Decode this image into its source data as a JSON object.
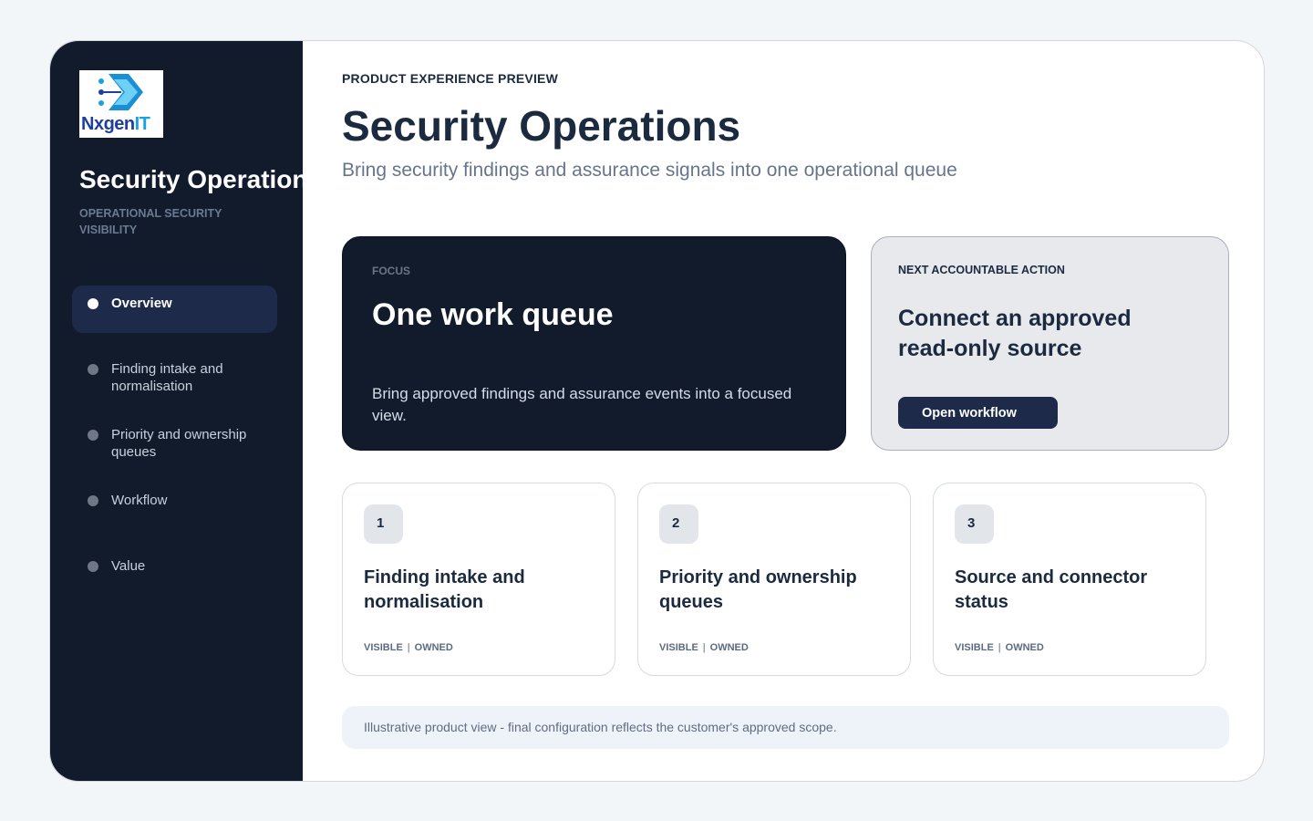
{
  "sidebar": {
    "logo_text_a": "Nxgen",
    "logo_text_b": "IT",
    "brand_title": "Security Operations",
    "brand_subtitle": "OPERATIONAL SECURITY VISIBILITY",
    "items": [
      {
        "label": "Overview",
        "active": true
      },
      {
        "label": "Finding intake and normalisation"
      },
      {
        "label": "Priority and ownership queues"
      },
      {
        "label": "Workflow"
      },
      {
        "label": "Value"
      }
    ]
  },
  "header": {
    "eyebrow": "PRODUCT EXPERIENCE PREVIEW",
    "title": "Security Operations",
    "subtitle": "Bring security findings and assurance signals into one operational queue"
  },
  "focus": {
    "eyebrow": "FOCUS",
    "title": "One work queue",
    "text": "Bring approved findings and assurance events into a focused view."
  },
  "next_action": {
    "eyebrow": "NEXT ACCOUNTABLE ACTION",
    "title": "Connect an approved read-only source",
    "button_label": "Open workflow"
  },
  "steps": [
    {
      "number": "1",
      "title": "Finding intake and normalisation",
      "tag_a": "VISIBLE",
      "sep": "|",
      "tag_b": "OWNED"
    },
    {
      "number": "2",
      "title": "Priority and ownership queues",
      "tag_a": "VISIBLE",
      "sep": "|",
      "tag_b": "OWNED"
    },
    {
      "number": "3",
      "title": "Source and connector status",
      "tag_a": "VISIBLE",
      "sep": "|",
      "tag_b": "OWNED"
    }
  ],
  "footer_note": "Illustrative product view - final configuration reflects the customer's approved scope.",
  "colors": {
    "sidebar_bg": "#111b2c",
    "nav_active_bg": "#1e2a49",
    "accent_button": "#1e2a49",
    "page_bg": "#f3f6f9"
  }
}
